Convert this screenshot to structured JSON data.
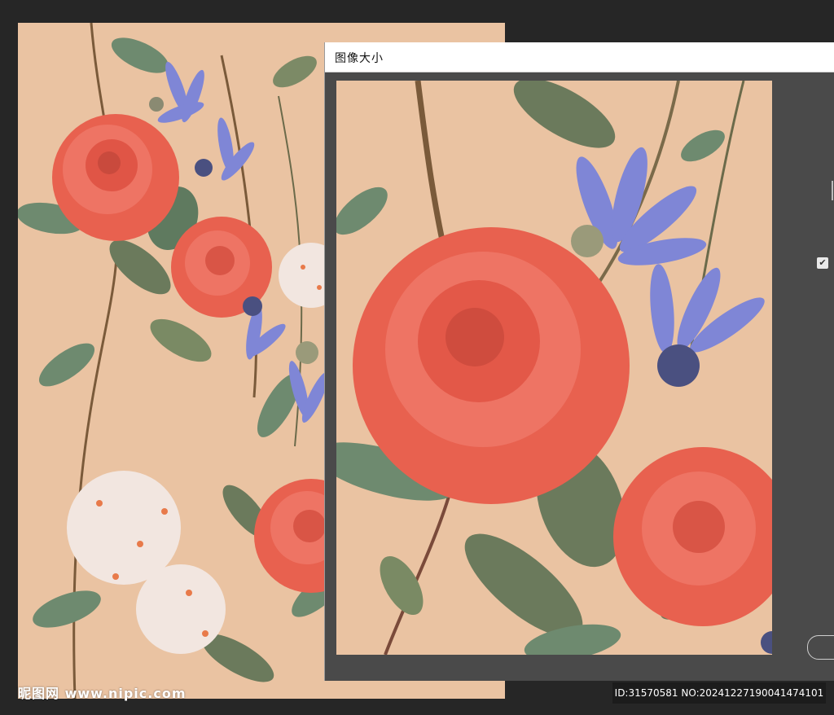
{
  "dialog": {
    "title": "图像大小"
  },
  "colors": {
    "background": "#262626",
    "artwork_ground": "#EAC3A2",
    "dialog_panel": "#4A4A4A",
    "rose": "#E8614F",
    "petal_blue": "#7F86D6",
    "leaf": "#6E8A6F"
  },
  "artwork": {
    "description_icon": "floral-pattern-image"
  },
  "watermark": {
    "site": "昵图网 www.nipic.com",
    "id_text": "ID:31570581 NO:20241227190041474101"
  }
}
